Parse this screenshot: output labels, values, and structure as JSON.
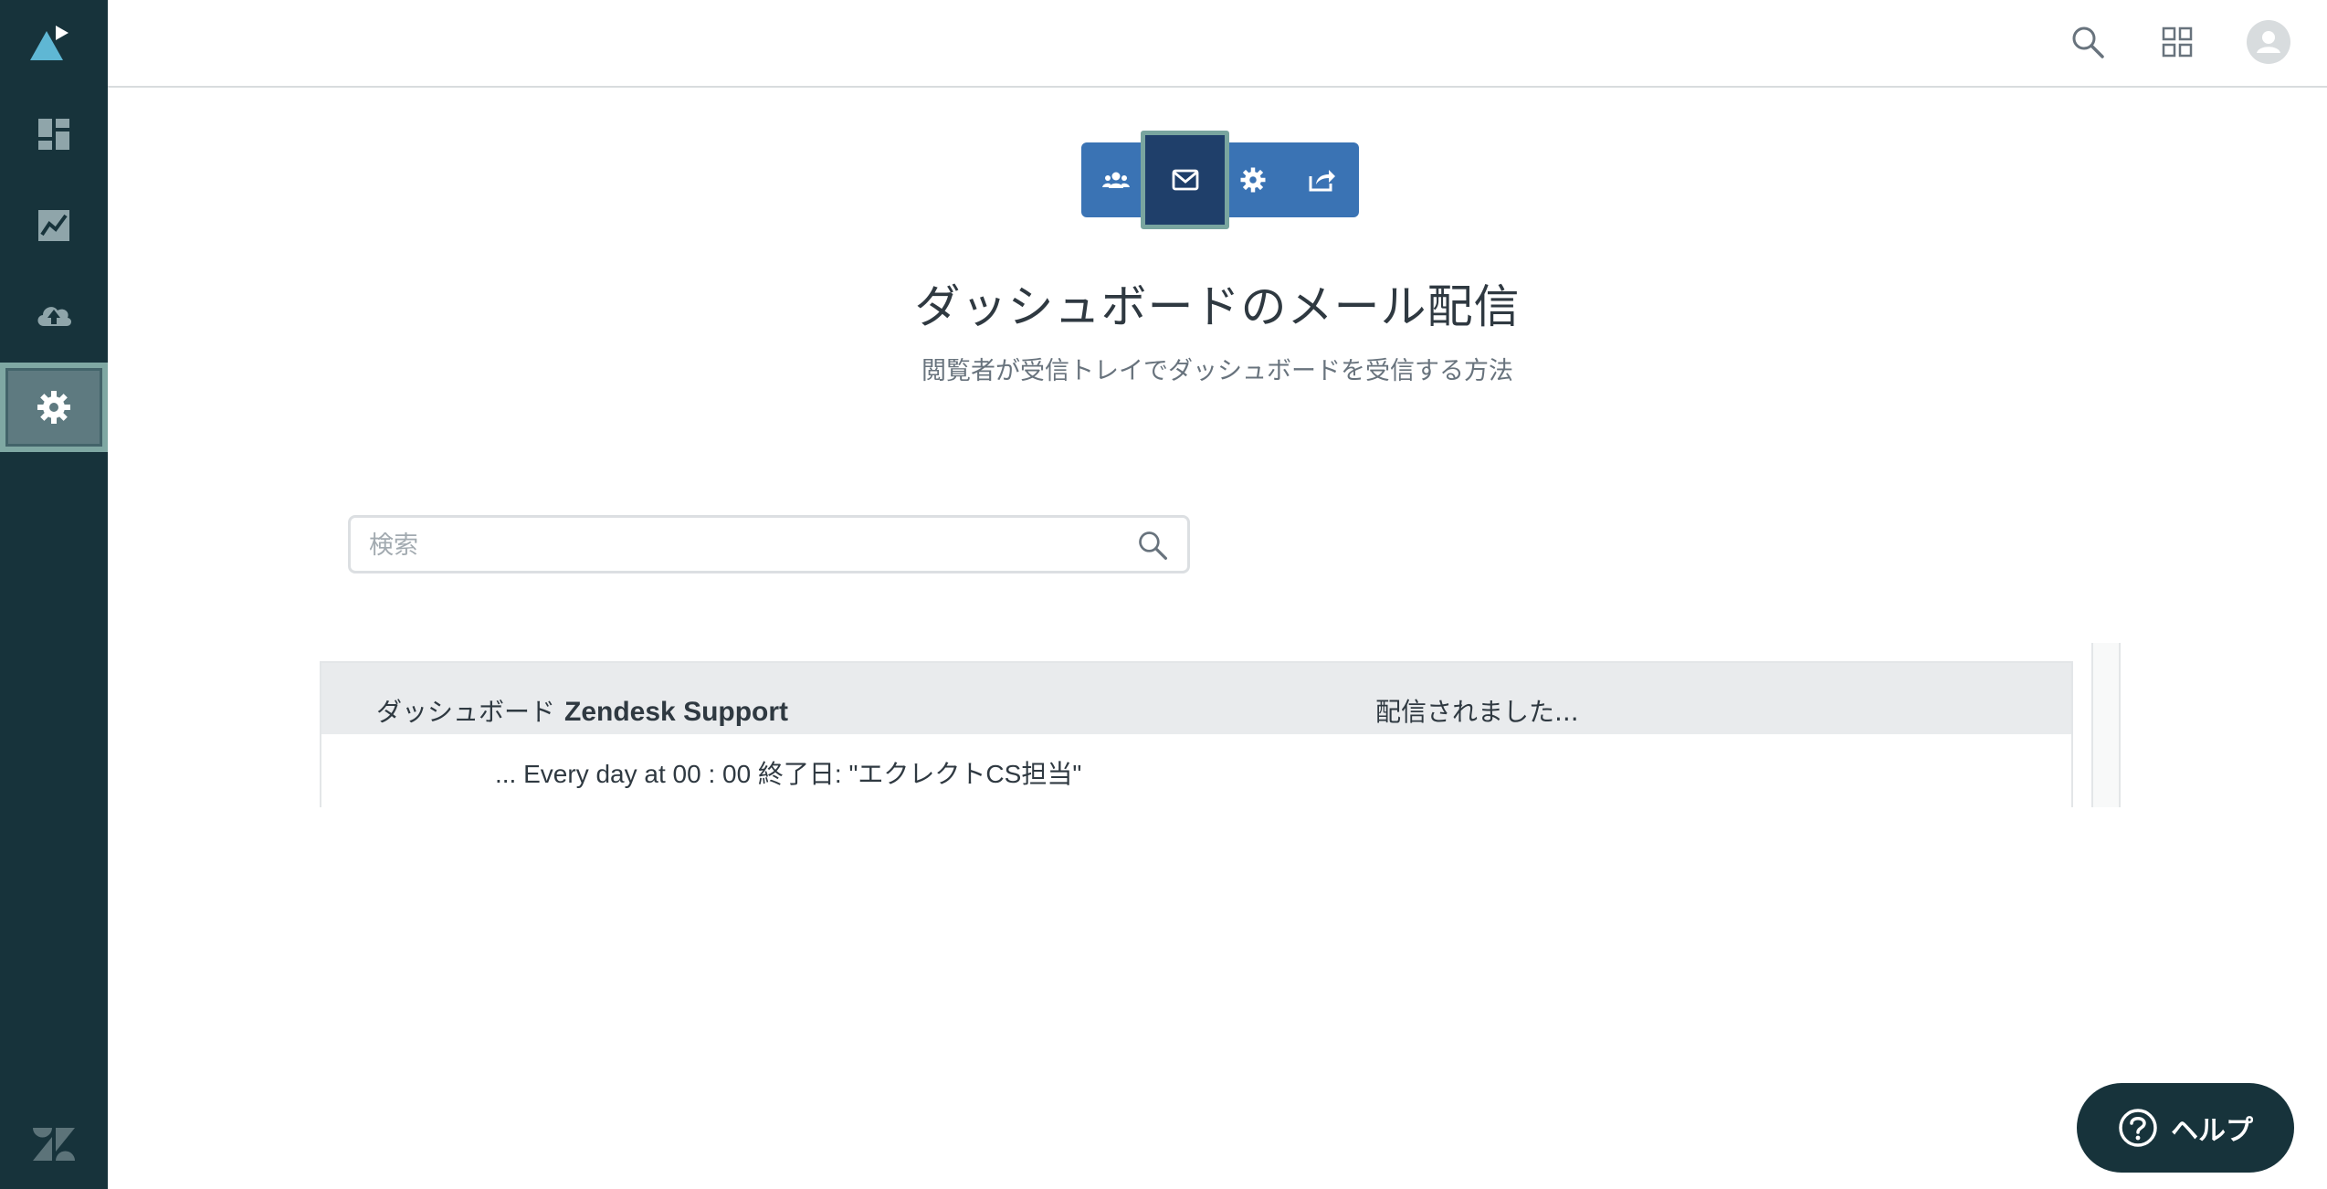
{
  "sidebar": {
    "items": [
      {
        "name": "logo",
        "icon": "triangle-logo-icon"
      },
      {
        "name": "dashboards",
        "icon": "dashboard-icon"
      },
      {
        "name": "analytics",
        "icon": "chart-icon"
      },
      {
        "name": "data-upload",
        "icon": "cloud-upload-icon"
      },
      {
        "name": "admin",
        "icon": "gear-icon",
        "active": true
      }
    ],
    "footer_icon": "zendesk-logo-icon"
  },
  "header": {
    "icons": [
      "search-icon",
      "apps-grid-icon",
      "avatar-icon"
    ]
  },
  "toolbar": {
    "buttons": [
      {
        "name": "users",
        "icon": "users-icon"
      },
      {
        "name": "mail",
        "icon": "mail-icon",
        "active": true
      },
      {
        "name": "settings",
        "icon": "gear-icon"
      },
      {
        "name": "share",
        "icon": "share-icon"
      }
    ]
  },
  "main": {
    "title": "ダッシュボードのメール配信",
    "subtitle": "閲覧者が受信トレイでダッシュボードを受信する方法"
  },
  "search": {
    "placeholder": "検索",
    "value": ""
  },
  "table": {
    "header": {
      "dashboard_label": "ダッシュボード",
      "dashboard_name": "Zendesk Support",
      "sent_label": "配信されました..."
    },
    "rows": [
      {
        "schedule": "... Every day at 00 : 00 終了日: \"エクレクトCS担当\""
      }
    ]
  },
  "help": {
    "label": "ヘルプ"
  },
  "colors": {
    "sidebar_bg": "#17333b",
    "toolbar_bg": "#3a73b4",
    "toolbar_active": "#1f3f6a",
    "highlight_border": "#7fa8a3"
  }
}
